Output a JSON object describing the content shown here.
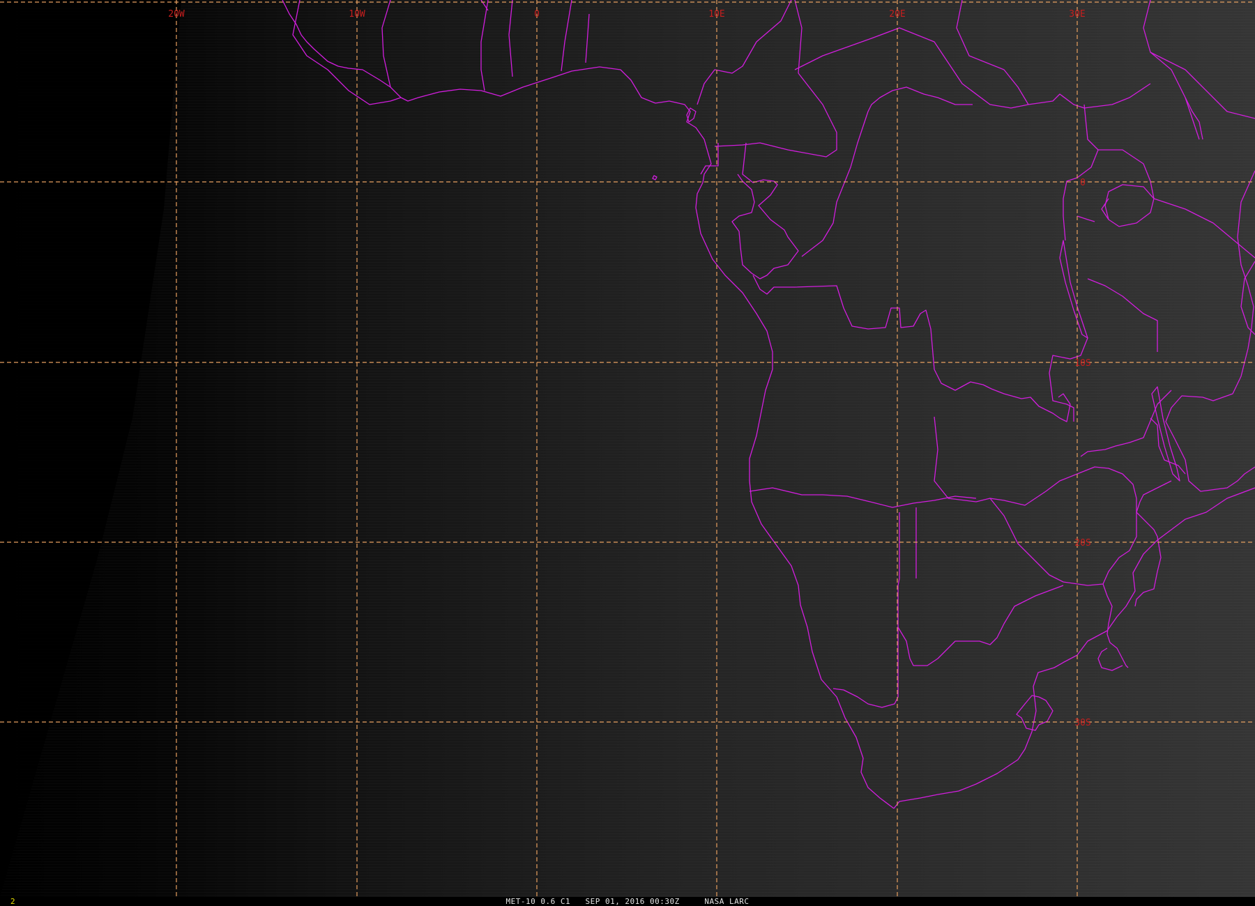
{
  "image": {
    "satellite": "MET-10",
    "channel": "0.6 C1",
    "datetime": "SEP 01, 2016 00:30Z",
    "source": "NASA LARC",
    "frame_number": "2"
  },
  "colors": {
    "grid_line": "#e8a060",
    "grid_label": "#c81e1e",
    "boundary": "#d21ede",
    "frame_number": "#e8e000",
    "caption": "#e6e6e6"
  },
  "gridlines": {
    "longitude_labels": [
      "20W",
      "10W",
      "0",
      "10E",
      "20E",
      "30E"
    ],
    "latitude_labels": [
      "0",
      "10S",
      "20S",
      "30S"
    ]
  },
  "map": {
    "region": "Southern Africa and South Atlantic",
    "boundaries": [
      "coastlines",
      "country borders"
    ]
  }
}
